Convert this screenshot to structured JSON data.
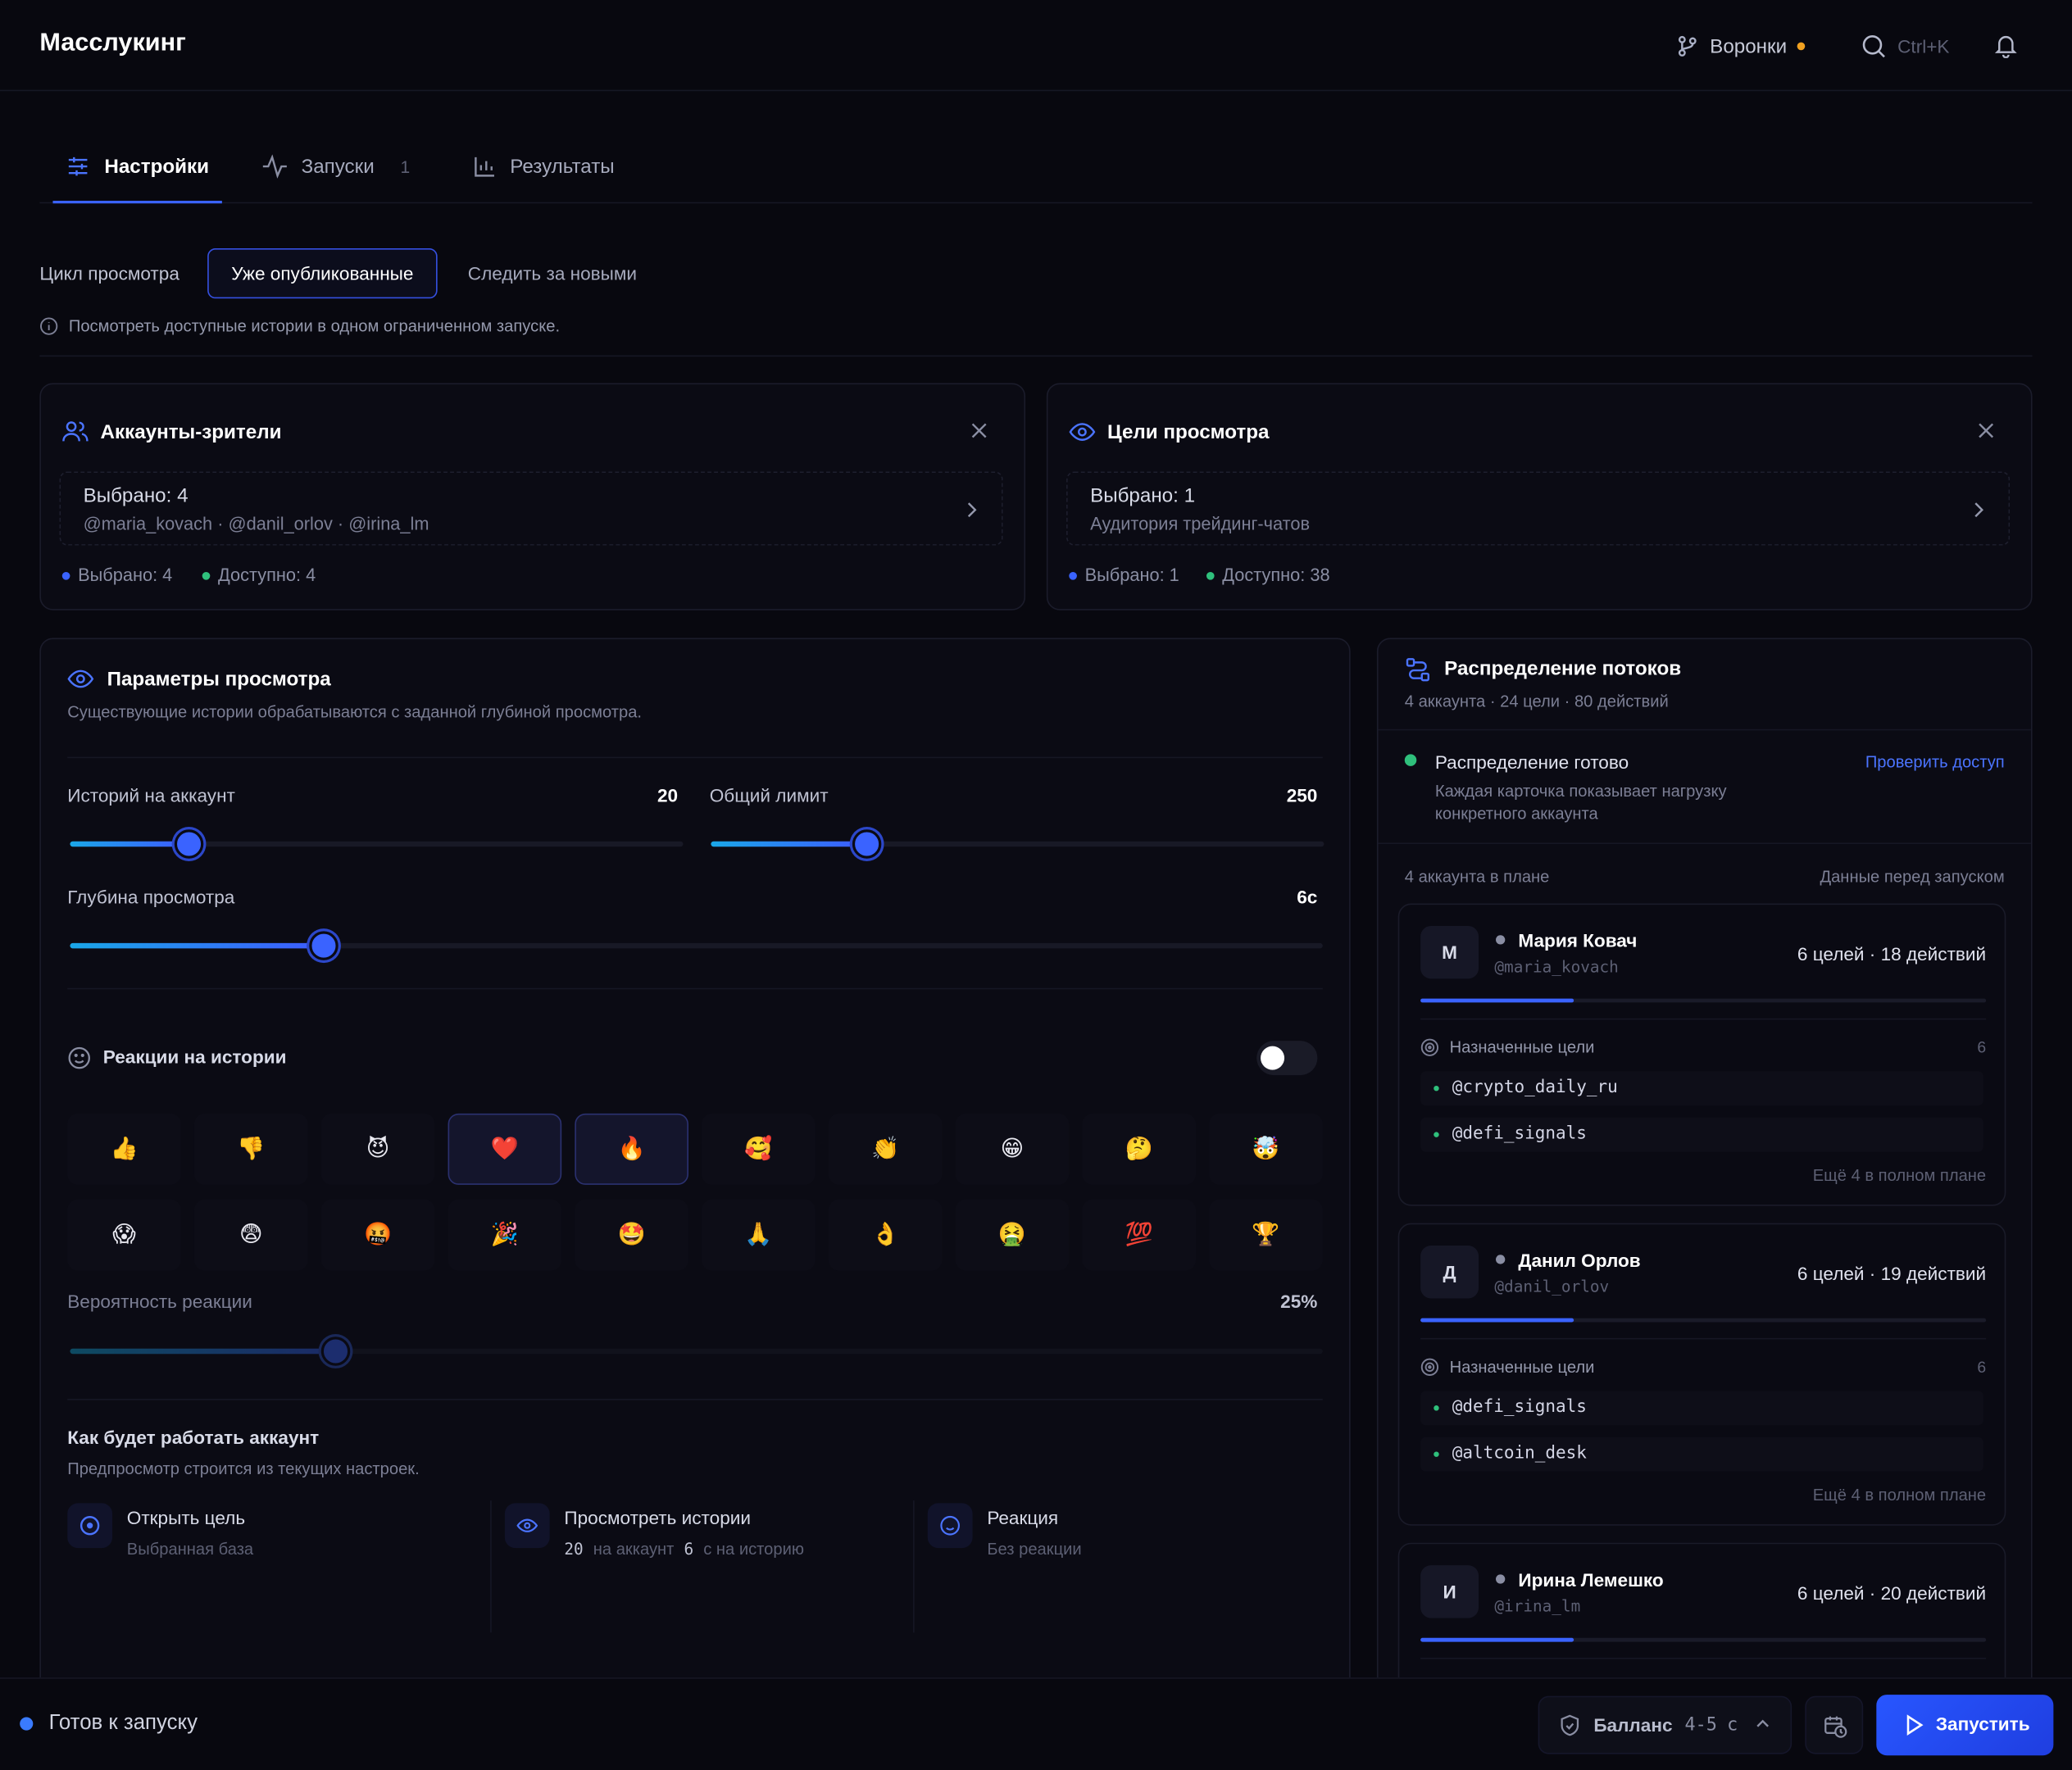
{
  "app": {
    "title": "Масслукинг"
  },
  "header": {
    "funnels_label": "Воронки",
    "search_shortcut": "Ctrl+K"
  },
  "tabs": [
    {
      "label": "Настройки",
      "count": ""
    },
    {
      "label": "Запуски",
      "count": "1"
    },
    {
      "label": "Результаты",
      "count": ""
    }
  ],
  "cycle": {
    "label": "Цикл просмотра",
    "options": [
      "Уже опубликованные",
      "Следить за новыми"
    ],
    "selected": "Уже опубликованные",
    "hint": "Посмотреть доступные истории в одном ограниченном запуске."
  },
  "viewers": {
    "title": "Аккаунты-зрители",
    "selected_text": "Выбрано: 4",
    "accounts_line": "@maria_kovach · @danil_orlov · @irina_lm",
    "stat_selected": "Выбрано: 4",
    "stat_available": "Доступно: 4"
  },
  "targets": {
    "title": "Цели просмотра",
    "selected_text": "Выбрано: 1",
    "sub_line": "Аудитория трейдинг-чатов",
    "stat_selected": "Выбрано: 1",
    "stat_available": "Доступно: 38"
  },
  "params": {
    "title": "Параметры просмотра",
    "subtitle": "Существующие истории обрабатываются с заданной глубиной просмотра.",
    "stories_per_account": {
      "label": "Историй на аккаунт",
      "value": "20",
      "fraction": 0.19
    },
    "total_limit": {
      "label": "Общий лимит",
      "value": "250",
      "fraction": 0.25
    },
    "depth": {
      "label": "Глубина просмотра",
      "value": "6с",
      "fraction": 0.2
    },
    "reactions": {
      "label": "Реакции на истории",
      "enabled": false,
      "emojis": [
        "👍",
        "👎",
        "😈",
        "❤️",
        "🔥",
        "🥰",
        "👏",
        "😁",
        "🤔",
        "🤯",
        "😱",
        "😨",
        "🤬",
        "🎉",
        "🤩",
        "🙏",
        "👌",
        "🤮",
        "💯",
        "🏆"
      ],
      "selected": [
        3,
        4
      ]
    },
    "probability": {
      "label": "Вероятность реакции",
      "value": "25%",
      "fraction": 0.21
    },
    "preview_title": "Как будет работать аккаунт",
    "preview_sub": "Предпросмотр строится из текущих настроек.",
    "steps": [
      {
        "title": "Открыть цель",
        "sub": "Выбранная база"
      },
      {
        "title": "Просмотреть истории",
        "n1": "20",
        "t1": "на аккаунт",
        "n2": "6",
        "t2": "с на историю"
      },
      {
        "title": "Реакция",
        "sub": "Без реакции"
      }
    ]
  },
  "distribution": {
    "title": "Распределение потоков",
    "summary": "4 аккаунта · 24 цели · 80 действий",
    "ready_title": "Распределение готово",
    "ready_sub": "Каждая карточка показывает нагрузку конкретного аккаунта",
    "check_link": "Проверить доступ",
    "plan_left": "4 аккаунта в плане",
    "plan_right": "Данные перед запуском",
    "accounts": [
      {
        "initial": "М",
        "name": "Мария Ковач",
        "handle": "@maria_kovach",
        "stats": "6 целей · 18 действий",
        "targets_label": "Назначенные цели",
        "targets_count": "6",
        "targets": [
          "@crypto_daily_ru",
          "@defi_signals"
        ],
        "more": "Ещё 4 в полном плане",
        "load": 0.27
      },
      {
        "initial": "Д",
        "name": "Данил Орлов",
        "handle": "@danil_orlov",
        "stats": "6 целей · 19 действий",
        "targets_label": "Назначенные цели",
        "targets_count": "6",
        "targets": [
          "@defi_signals",
          "@altcoin_desk"
        ],
        "more": "Ещё 4 в полном плане",
        "load": 0.27
      },
      {
        "initial": "И",
        "name": "Ирина Лемешко",
        "handle": "@irina_lm",
        "stats": "6 целей · 20 действий",
        "load": 0.27
      }
    ]
  },
  "footer": {
    "status": "Готов к запуску",
    "balance_label": "Балланс",
    "balance_value": "4-5",
    "balance_unit": "с",
    "launch_label": "Запустить"
  },
  "colors": {
    "accent": "#3a63ff",
    "green": "#2fc07c",
    "amber": "#f0a020",
    "link": "#4b74ff"
  }
}
